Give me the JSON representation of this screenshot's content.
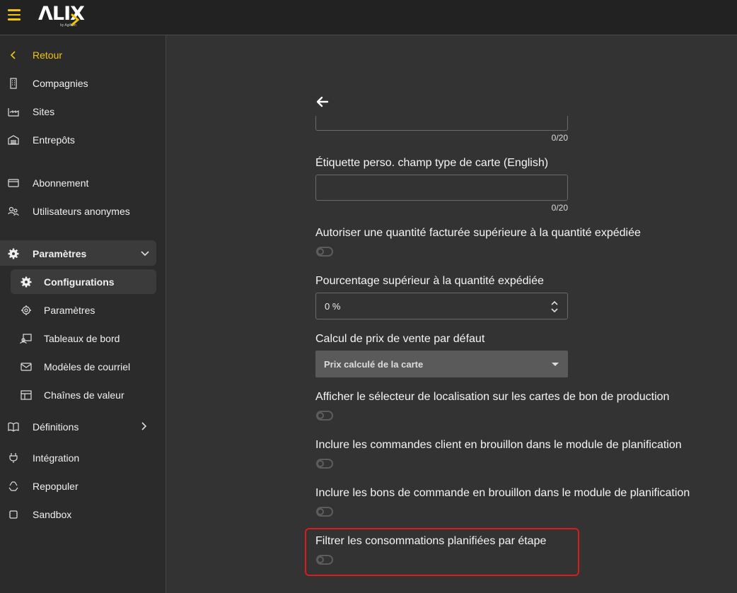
{
  "app": {
    "logo_text": "ΛLIX",
    "logo_sub": "by Agilium"
  },
  "sidebar": {
    "back": "Retour",
    "items": [
      {
        "label": "Compagnies",
        "icon": "building-icon"
      },
      {
        "label": "Sites",
        "icon": "factory-icon"
      },
      {
        "label": "Entrepôts",
        "icon": "warehouse-icon"
      },
      {
        "label": "Abonnement",
        "icon": "credit-card-icon"
      },
      {
        "label": "Utilisateurs anonymes",
        "icon": "anonymous-users-icon"
      }
    ],
    "settings_group": "Paramètres",
    "settings_sub": [
      {
        "label": "Configurations",
        "icon": "gear-icon"
      },
      {
        "label": "Paramètres",
        "icon": "gear-outline-icon"
      },
      {
        "label": "Tableaux de bord",
        "icon": "dashboard-icon"
      },
      {
        "label": "Modèles de courriel",
        "icon": "mail-icon"
      },
      {
        "label": "Chaînes de valeur",
        "icon": "table-icon"
      }
    ],
    "definitions": "Définitions",
    "integration": "Intégration",
    "repopulate": "Repopuler",
    "sandbox": "Sandbox"
  },
  "form": {
    "top_counter": "0/20",
    "custom_label_title": "Étiquette perso. champ type de carte (English)",
    "custom_label_value": "",
    "custom_label_counter": "0/20",
    "allow_higher_qty": "Autoriser une quantité facturée supérieure à la quantité expédiée",
    "percentage_title": "Pourcentage supérieur à la quantité expédiée",
    "percentage_value": "0 %",
    "price_calc_title": "Calcul de prix de vente par défaut",
    "price_calc_value": "Prix calculé de la carte",
    "show_location_selector": "Afficher le sélecteur de localisation sur les cartes de bon de production",
    "include_draft_client_orders": "Inclure les commandes client en brouillon dans le module de planification",
    "include_draft_purchase_orders": "Inclure les bons de commande en brouillon dans le module de planification",
    "filter_consumptions": "Filtrer les consommations planifiées par étape"
  },
  "toggles": {
    "allow_higher_qty": false,
    "show_location_selector": false,
    "include_draft_client_orders": false,
    "include_draft_purchase_orders": false,
    "filter_consumptions": false
  },
  "colors": {
    "accent": "#f2c40f",
    "highlight_border": "#d91c1c"
  }
}
